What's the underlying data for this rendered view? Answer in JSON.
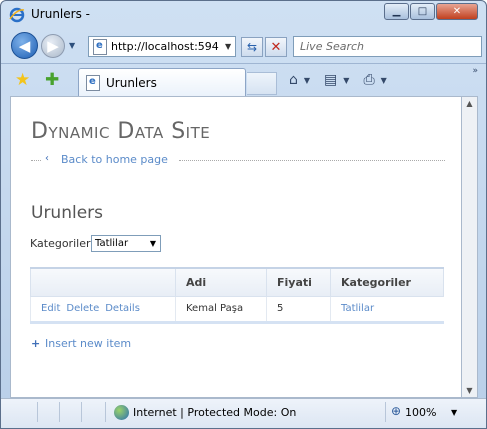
{
  "window": {
    "title": "Urunlers -",
    "minimize": "▁",
    "maximize": "□",
    "close": "✕"
  },
  "nav": {
    "address": "http://localhost:594",
    "search_placeholder": "Live Search"
  },
  "tabs": [
    {
      "label": "Urunlers"
    }
  ],
  "toolbar_icons": [
    "home-icon",
    "rss-icon",
    "print-icon"
  ],
  "content": {
    "site_title": "Dynamic Data Site",
    "home_link": "Back to home page",
    "page_title": "Urunlers",
    "filter": {
      "label": "Kategoriler",
      "selected": "Tatlilar"
    },
    "grid": {
      "columns": [
        "",
        "Adi",
        "Fiyati",
        "Kategoriler"
      ],
      "rows": [
        {
          "actions": [
            "Edit",
            "Delete",
            "Details"
          ],
          "adi": "Kemal Paşa",
          "fiyati": "5",
          "kategoriler": "Tatlilar"
        }
      ]
    },
    "insert_link": "Insert new item"
  },
  "status": {
    "zone": "Internet | Protected Mode: On",
    "zoom": "100%"
  },
  "colors": {
    "link": "#5b8bc9",
    "chrome": "#cfe0f3"
  }
}
